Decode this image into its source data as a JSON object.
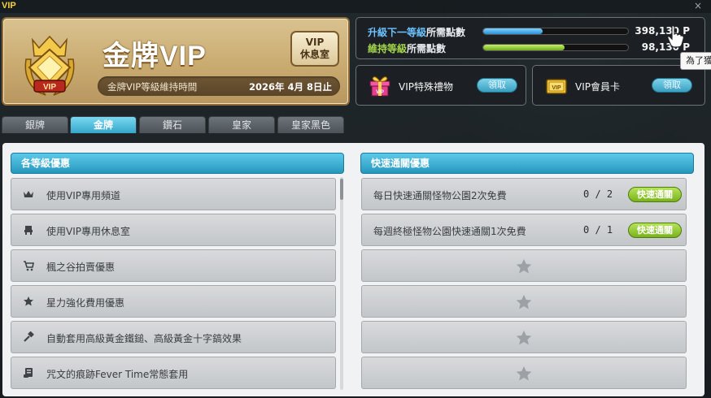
{
  "window": {
    "title": "VIP",
    "close": "×"
  },
  "vip": {
    "name": "金牌VIP",
    "badge_text": "VIP",
    "lounge": [
      "VIP",
      "休息室"
    ],
    "maintain_label": "金牌VIP等級維持時間",
    "maintain_date": "2026年 4月 8日止"
  },
  "points": {
    "next_level": {
      "highlight": "升級下一等級",
      "suffix": "所需點數",
      "value": "398,130 P",
      "progress": 0.41
    },
    "maintain": {
      "highlight": "維持等級",
      "suffix": "所需點數",
      "value": "98,130 P",
      "progress": 0.56
    }
  },
  "rewards": [
    {
      "icon": "gift-box-icon",
      "label": "VIP特殊禮物",
      "button": "領取"
    },
    {
      "icon": "vip-card-icon",
      "label": "VIP會員卡",
      "button": "領取"
    }
  ],
  "tabs": [
    "銀牌",
    "金牌",
    "鑽石",
    "皇家",
    "皇家黑色"
  ],
  "active_tab": 1,
  "benefits": {
    "header": "各等級優惠",
    "items": [
      {
        "icon": "crown-icon",
        "label": "使用VIP專用頻道"
      },
      {
        "icon": "chair-icon",
        "label": "使用VIP專用休息室"
      },
      {
        "icon": "cart-icon",
        "label": "楓之谷拍賣優惠"
      },
      {
        "icon": "star-icon",
        "label": "星力強化費用優惠"
      },
      {
        "icon": "hammer-icon",
        "label": "自動套用高級黃金鐵鎚、高級黃金十字鎬效果"
      },
      {
        "icon": "scroll-icon",
        "label": "咒文的痕跡Fever Time常態套用"
      }
    ]
  },
  "fastclear": {
    "header": "快速通關優惠",
    "items": [
      {
        "label": "每日快速通關怪物公園2次免費",
        "count": "0 / 2",
        "button": "快速通關"
      },
      {
        "label": "每週終極怪物公園快速通關1次免費",
        "count": "0 / 1",
        "button": "快速通關"
      }
    ],
    "empty_slots": 4
  },
  "tooltip": "為了獲",
  "colors": {
    "accent_blue": "#34a6cb",
    "accent_green": "#79b21c",
    "gold": "#c9ab70"
  }
}
